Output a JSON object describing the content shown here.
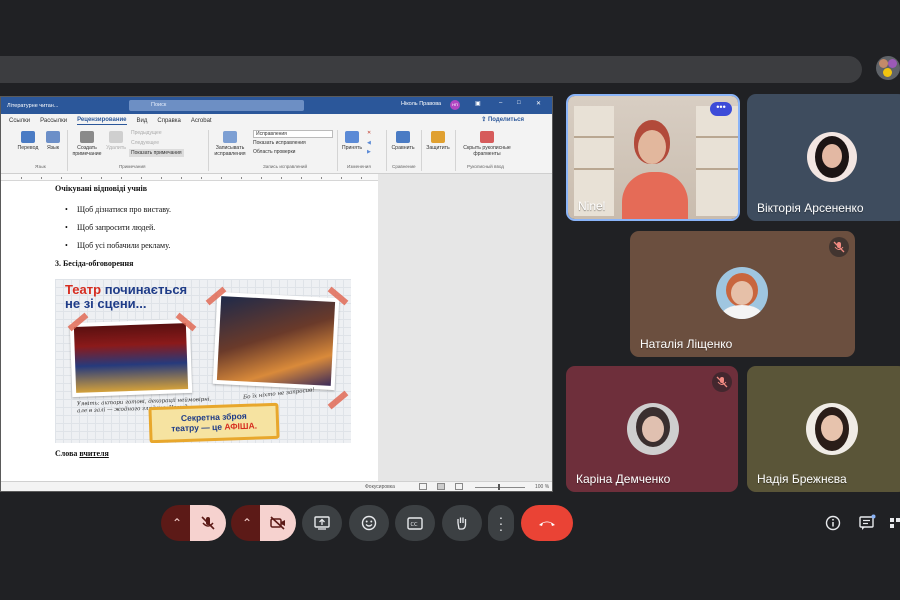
{
  "word": {
    "doc_title": "Літературне читан...",
    "search_placeholder": "Поиск",
    "user_name": "Ніколь Правова",
    "user_initials": "НП",
    "tabs": [
      "Ссылки",
      "Рассылки",
      "Рецензирование",
      "Вид",
      "Справка",
      "Acrobat"
    ],
    "share_label": "Поделиться",
    "ribbon": {
      "spelling": "Перевод",
      "language": "Язык",
      "new_comment": "Создать примечание",
      "delete": "Удалить",
      "previous": "Предыдущее",
      "next": "Следующее",
      "show_comments": "Показать примечания",
      "track_changes": "Записывать исправления",
      "markup_mode": "Исправления",
      "show_markup": "Показать исправления",
      "reviewing_pane": "Область проверки",
      "accept": "Принять",
      "compare": "Сравнить",
      "protect": "Защитить",
      "hide_ink": "Скрыть рукописные фрагменты",
      "grp_lang": "Язык",
      "grp_comments": "Примечания",
      "grp_tracking": "Запись исправлений",
      "grp_changes": "Изменения",
      "grp_compare": "Сравнение",
      "grp_ink": "Рукописный ввод"
    },
    "doc": {
      "heading1": "Очікувані відповіді учнів",
      "bullets": [
        "Щоб дізнатися про виставу.",
        "Щоб запросити людей.",
        "Щоб усі побачили рекламу."
      ],
      "heading2": "3. Бесіда-обговорення",
      "poster": {
        "title_a": "Театр",
        "title_b": "починається",
        "title_c": "не зі сцени...",
        "caption1": "Уявіть: актори готові, декорації неймовірні, але в залі — жодного глядача. Чому?",
        "caption2": "Бо їх ніхто не запросив!",
        "sign_a": "Секретна зброя",
        "sign_b": "театру — це",
        "sign_c": "АФІША."
      },
      "footer_label": "Слова",
      "footer_underlined": "вчителя"
    },
    "status": {
      "focus": "Фокусировка",
      "zoom": "100 %"
    }
  },
  "participants": [
    {
      "name": "Ninel",
      "color": "#4a6fa5"
    },
    {
      "name": "Вікторія Арсененко",
      "color": "#3e4c5e"
    },
    {
      "name": "Наталія Ліщенко",
      "color": "#6b4f3f"
    },
    {
      "name": "Каріна Демченко",
      "color": "#6e2f3b"
    },
    {
      "name": "Надія Брежнєва",
      "color": "#5a5538"
    }
  ],
  "controls": {
    "accent_mute": "#f6d2cf",
    "end_call_color": "#ea4335"
  }
}
